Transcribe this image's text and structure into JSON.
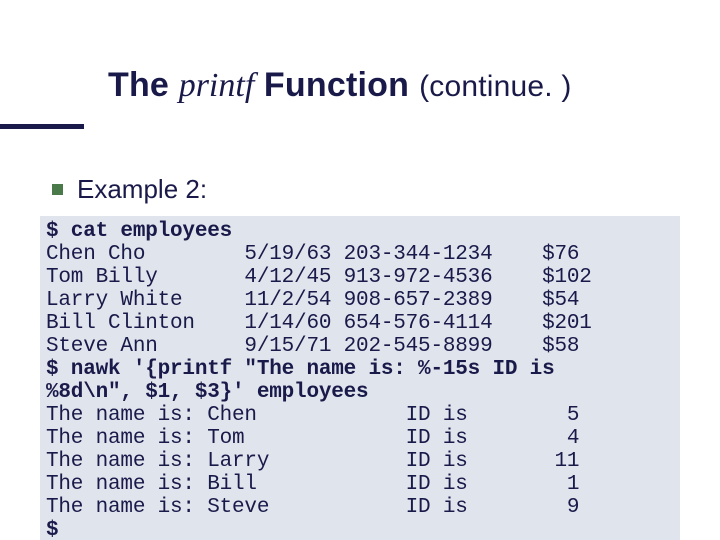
{
  "title": {
    "pre": "The ",
    "fn": "printf",
    "post": " Function",
    "cont": "(continue. )"
  },
  "subhead": "Example 2:",
  "code": {
    "l0": "$ cat employees",
    "l1": "Chen Cho        5/19/63 203-344-1234    $76",
    "l2": "Tom Billy       4/12/45 913-972-4536    $102",
    "l3": "Larry White     11/2/54 908-657-2389    $54",
    "l4": "Bill Clinton    1/14/60 654-576-4114    $201",
    "l5": "Steve Ann       9/15/71 202-545-8899    $58",
    "l6": "$ nawk '{printf \"The name is: %-15s ID is",
    "l7": "%8d\\n\", $1, $3}' employees",
    "l8": "The name is: Chen            ID is        5",
    "l9": "The name is: Tom             ID is        4",
    "l10": "The name is: Larry           ID is       11",
    "l11": "The name is: Bill            ID is        1",
    "l12": "The name is: Steve           ID is        9",
    "l13": "$"
  }
}
